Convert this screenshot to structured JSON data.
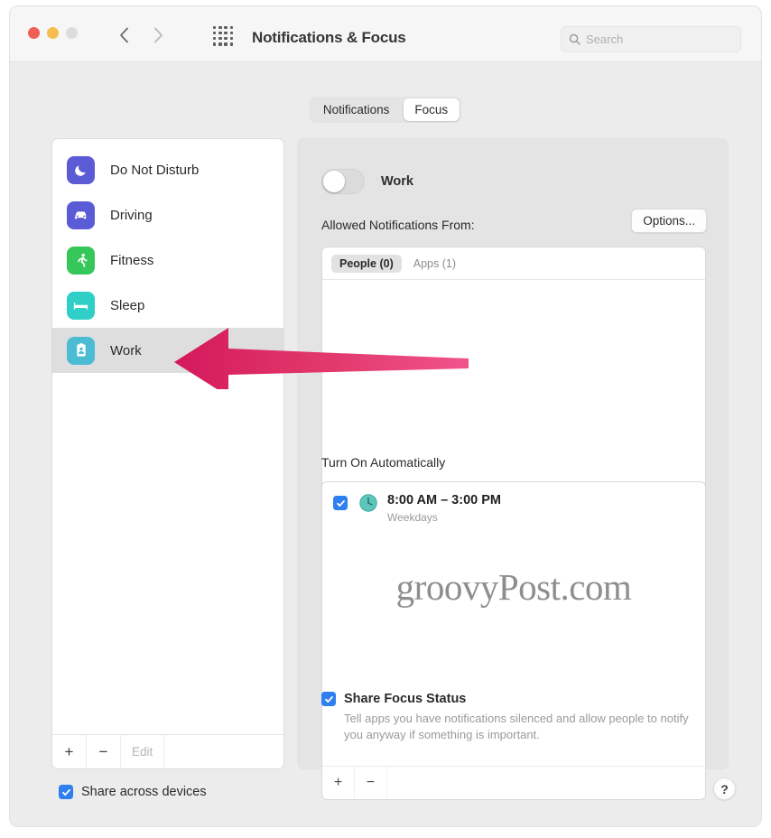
{
  "window": {
    "title": "Notifications & Focus",
    "traffic_lights": [
      "close-red",
      "minimize-yellow",
      "zoom-gray-disabled"
    ],
    "nav": {
      "back": "back-chevron",
      "forward": "forward-chevron",
      "grid": "show-all-grid"
    },
    "search": {
      "placeholder": "Search",
      "value": "",
      "icon": "search-icon"
    }
  },
  "tabs": [
    {
      "label": "Notifications",
      "active": false
    },
    {
      "label": "Focus",
      "active": true
    }
  ],
  "sidebar": {
    "items": [
      {
        "label": "Do Not Disturb",
        "icon": "moon-icon",
        "color": "#5b5bd6",
        "selected": false
      },
      {
        "label": "Driving",
        "icon": "car-icon",
        "color": "#5b5bd6",
        "selected": false
      },
      {
        "label": "Fitness",
        "icon": "runner-icon",
        "color": "#35c759",
        "selected": false
      },
      {
        "label": "Sleep",
        "icon": "bed-icon",
        "color": "#2fcfc8",
        "selected": false
      },
      {
        "label": "Work",
        "icon": "id-badge-icon",
        "color": "#4cbcd4",
        "selected": true
      }
    ],
    "footer": {
      "add_label": "+",
      "remove_label": "−",
      "edit_label": "Edit",
      "edit_disabled": true
    }
  },
  "panel": {
    "focus_toggle": {
      "label": "Work",
      "on": false
    },
    "allowed": {
      "heading": "Allowed Notifications From:",
      "options_button": "Options...",
      "segments": [
        {
          "label": "People (0)",
          "active": true
        },
        {
          "label": "Apps (1)",
          "active": false
        }
      ],
      "rows": [],
      "footer": {
        "add_label": "+",
        "remove_label": "−"
      }
    },
    "automatically": {
      "heading": "Turn On Automatically",
      "schedules": [
        {
          "checked": true,
          "icon": "clock-icon",
          "time": "8:00 AM – 3:00 PM",
          "days": "Weekdays"
        }
      ],
      "footer": {
        "add_label": "+",
        "remove_label": "−"
      }
    },
    "share_focus_status": {
      "checked": true,
      "title": "Share Focus Status",
      "description": "Tell apps you have notifications silenced and allow people to notify you anyway if something is important."
    }
  },
  "bottom": {
    "share_across_devices": {
      "label": "Share across devices",
      "checked": true
    },
    "help_label": "?"
  },
  "watermark": {
    "text": "groovyPost.com"
  },
  "annotation": {
    "type": "arrow",
    "direction": "left",
    "color": "#dd2f66",
    "points_at": "sidebar-item-work"
  },
  "colors": {
    "accent_blue": "#2f7ff0",
    "arrow_pink": "#dd2f66",
    "window_bg": "#ececec",
    "panel_bg": "#e4e4e4",
    "selected_row": "#dedede"
  }
}
